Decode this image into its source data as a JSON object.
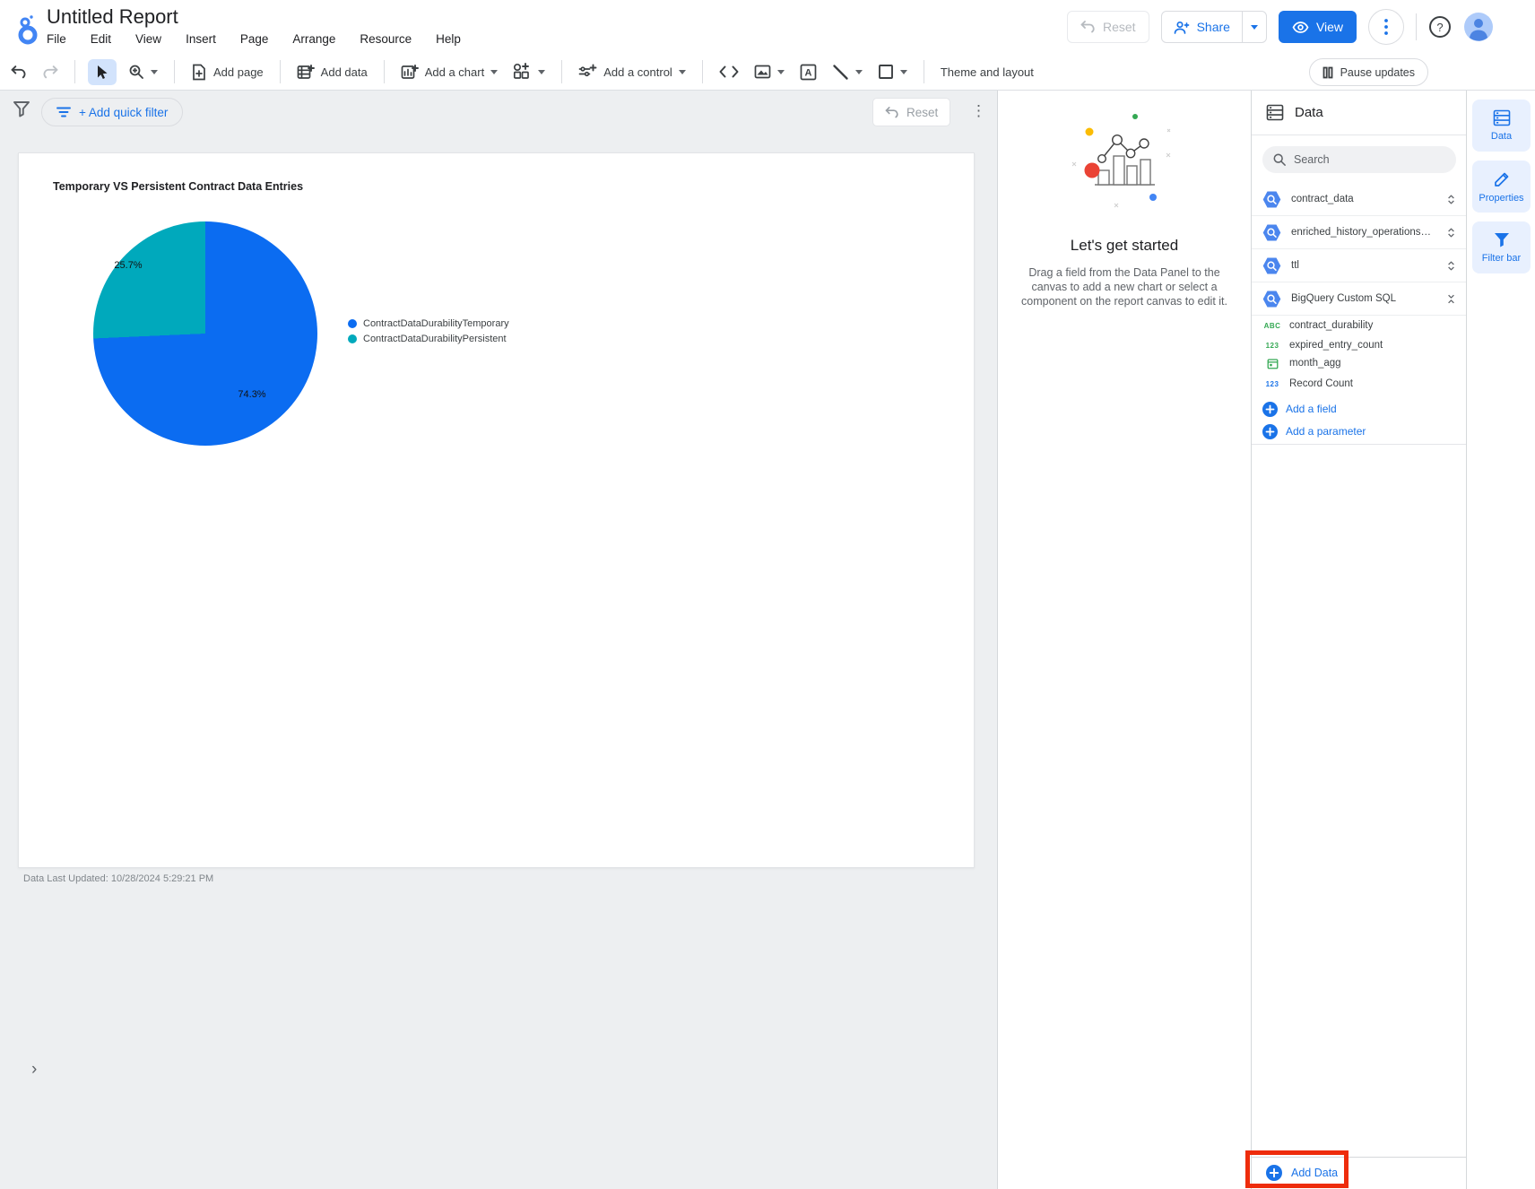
{
  "header": {
    "title": "Untitled Report",
    "menus": [
      "File",
      "Edit",
      "View",
      "Insert",
      "Page",
      "Arrange",
      "Resource",
      "Help"
    ],
    "reset_label": "Reset",
    "share_label": "Share",
    "view_label": "View",
    "pause_updates_label": "Pause updates"
  },
  "toolbar": {
    "add_page": "Add page",
    "add_data": "Add data",
    "add_chart": "Add a chart",
    "add_control": "Add a control",
    "theme_layout": "Theme and layout"
  },
  "filter_bar": {
    "add_quick_filter": "+ Add quick filter",
    "reset_label": "Reset",
    "kebab": "⋮"
  },
  "canvas": {
    "last_updated": "Data Last Updated: 10/28/2024 5:29:21 PM"
  },
  "chart_data": {
    "type": "pie",
    "title": "Temporary VS Persistent Contract Data Entries",
    "labels": [
      "ContractDataDurabilityTemporary",
      "ContractDataDurabilityPersistent"
    ],
    "values": [
      74.3,
      25.7
    ],
    "value_labels": [
      "74.3%",
      "25.7%"
    ],
    "colors": [
      "#0b6cf1",
      "#00a9bc"
    ],
    "legend_position": "right",
    "start_angle_deg": 0,
    "direction": "clockwise"
  },
  "getting_started": {
    "title": "Let's get started",
    "body": "Drag a field from the Data Panel to the canvas to add a new chart or select a component on the report canvas to edit it."
  },
  "data_panel": {
    "title": "Data",
    "search_placeholder": "Search",
    "sources": [
      {
        "name": "contract_data",
        "expanded": false
      },
      {
        "name": "enriched_history_operations_sorob...",
        "expanded": false
      },
      {
        "name": "ttl",
        "expanded": false
      },
      {
        "name": "BigQuery Custom SQL",
        "expanded": true
      }
    ],
    "fields": [
      {
        "name": "contract_durability",
        "type": "text",
        "glyph": "ABC"
      },
      {
        "name": "expired_entry_count",
        "type": "number",
        "glyph": "123"
      },
      {
        "name": "month_agg",
        "type": "date",
        "glyph": ""
      },
      {
        "name": "Record Count",
        "type": "metric",
        "glyph": "123"
      }
    ],
    "add_field": "Add a field",
    "add_parameter": "Add a parameter",
    "add_data": "Add Data"
  },
  "right_rail": {
    "tabs": [
      {
        "label": "Data"
      },
      {
        "label": "Properties"
      },
      {
        "label": "Filter bar"
      }
    ],
    "collapse": "›"
  },
  "annotation": {
    "highlight_color": "#ee2c0c"
  }
}
